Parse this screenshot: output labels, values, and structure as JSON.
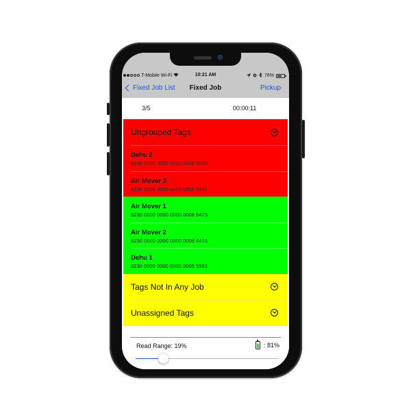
{
  "status_bar": {
    "carrier": "T-Mobile Wi-Fi",
    "time": "10:21 AM",
    "battery": "76%",
    "battery_level": 0.76
  },
  "nav": {
    "back_label": "Fixed Job List",
    "title": "Fixed Job",
    "right_label": "Pickup"
  },
  "info": {
    "count": "3/5",
    "timer": "00:00:11"
  },
  "colors": {
    "red": "#ff0000",
    "green": "#00ff00",
    "yellow": "#ffff00",
    "accent": "#1a56d6"
  },
  "sections": {
    "ungrouped": {
      "title": "Ungrouped Tags",
      "icon": "chevron-down-circle-icon",
      "tags": [
        {
          "name": "Dehu 2",
          "epc": "8230 0000 0000 0000 0005 5980"
        },
        {
          "name": "Air Mover 3",
          "epc": "8230 0000 0000 0000 0005 5981"
        }
      ]
    },
    "found": {
      "tags": [
        {
          "name": "Air Mover 1",
          "epc": "8230 0000 0000 0000 0008 6475"
        },
        {
          "name": "Air Mover 2",
          "epc": "8230 0000 0000 0000 0008 6476"
        },
        {
          "name": "Dehu 1",
          "epc": "8230 0000 0000 0000 0005 5982"
        }
      ]
    },
    "not_in_job": {
      "title": "Tags Not In Any Job",
      "icon": "chevron-down-circle-icon"
    },
    "unassigned": {
      "title": "Unassigned Tags",
      "icon": "chevron-down-circle-icon"
    }
  },
  "bottom": {
    "read_range_label": "Read Range: 19%",
    "read_range_value": 0.19,
    "reader_battery_label": ": 81%",
    "reader_battery_value": 0.81
  }
}
